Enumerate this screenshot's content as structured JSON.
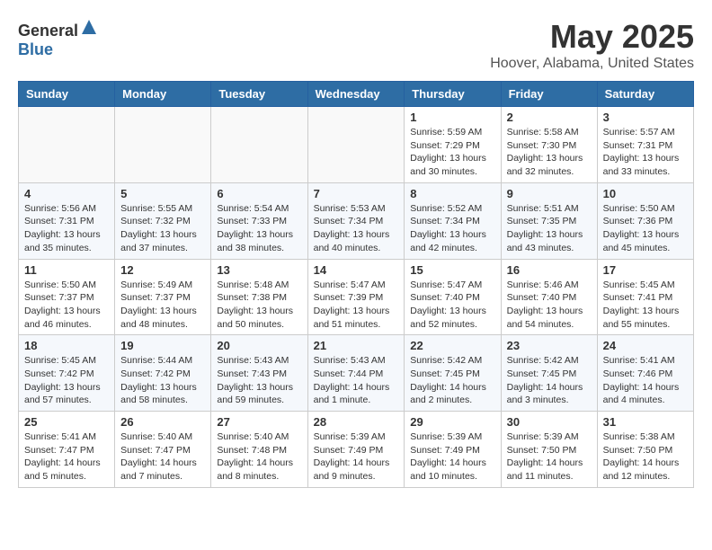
{
  "header": {
    "logo_general": "General",
    "logo_blue": "Blue",
    "month": "May 2025",
    "location": "Hoover, Alabama, United States"
  },
  "days_of_week": [
    "Sunday",
    "Monday",
    "Tuesday",
    "Wednesday",
    "Thursday",
    "Friday",
    "Saturday"
  ],
  "weeks": [
    [
      {
        "day": "",
        "info": ""
      },
      {
        "day": "",
        "info": ""
      },
      {
        "day": "",
        "info": ""
      },
      {
        "day": "",
        "info": ""
      },
      {
        "day": "1",
        "info": "Sunrise: 5:59 AM\nSunset: 7:29 PM\nDaylight: 13 hours and 30 minutes."
      },
      {
        "day": "2",
        "info": "Sunrise: 5:58 AM\nSunset: 7:30 PM\nDaylight: 13 hours and 32 minutes."
      },
      {
        "day": "3",
        "info": "Sunrise: 5:57 AM\nSunset: 7:31 PM\nDaylight: 13 hours and 33 minutes."
      }
    ],
    [
      {
        "day": "4",
        "info": "Sunrise: 5:56 AM\nSunset: 7:31 PM\nDaylight: 13 hours and 35 minutes."
      },
      {
        "day": "5",
        "info": "Sunrise: 5:55 AM\nSunset: 7:32 PM\nDaylight: 13 hours and 37 minutes."
      },
      {
        "day": "6",
        "info": "Sunrise: 5:54 AM\nSunset: 7:33 PM\nDaylight: 13 hours and 38 minutes."
      },
      {
        "day": "7",
        "info": "Sunrise: 5:53 AM\nSunset: 7:34 PM\nDaylight: 13 hours and 40 minutes."
      },
      {
        "day": "8",
        "info": "Sunrise: 5:52 AM\nSunset: 7:34 PM\nDaylight: 13 hours and 42 minutes."
      },
      {
        "day": "9",
        "info": "Sunrise: 5:51 AM\nSunset: 7:35 PM\nDaylight: 13 hours and 43 minutes."
      },
      {
        "day": "10",
        "info": "Sunrise: 5:50 AM\nSunset: 7:36 PM\nDaylight: 13 hours and 45 minutes."
      }
    ],
    [
      {
        "day": "11",
        "info": "Sunrise: 5:50 AM\nSunset: 7:37 PM\nDaylight: 13 hours and 46 minutes."
      },
      {
        "day": "12",
        "info": "Sunrise: 5:49 AM\nSunset: 7:37 PM\nDaylight: 13 hours and 48 minutes."
      },
      {
        "day": "13",
        "info": "Sunrise: 5:48 AM\nSunset: 7:38 PM\nDaylight: 13 hours and 50 minutes."
      },
      {
        "day": "14",
        "info": "Sunrise: 5:47 AM\nSunset: 7:39 PM\nDaylight: 13 hours and 51 minutes."
      },
      {
        "day": "15",
        "info": "Sunrise: 5:47 AM\nSunset: 7:40 PM\nDaylight: 13 hours and 52 minutes."
      },
      {
        "day": "16",
        "info": "Sunrise: 5:46 AM\nSunset: 7:40 PM\nDaylight: 13 hours and 54 minutes."
      },
      {
        "day": "17",
        "info": "Sunrise: 5:45 AM\nSunset: 7:41 PM\nDaylight: 13 hours and 55 minutes."
      }
    ],
    [
      {
        "day": "18",
        "info": "Sunrise: 5:45 AM\nSunset: 7:42 PM\nDaylight: 13 hours and 57 minutes."
      },
      {
        "day": "19",
        "info": "Sunrise: 5:44 AM\nSunset: 7:42 PM\nDaylight: 13 hours and 58 minutes."
      },
      {
        "day": "20",
        "info": "Sunrise: 5:43 AM\nSunset: 7:43 PM\nDaylight: 13 hours and 59 minutes."
      },
      {
        "day": "21",
        "info": "Sunrise: 5:43 AM\nSunset: 7:44 PM\nDaylight: 14 hours and 1 minute."
      },
      {
        "day": "22",
        "info": "Sunrise: 5:42 AM\nSunset: 7:45 PM\nDaylight: 14 hours and 2 minutes."
      },
      {
        "day": "23",
        "info": "Sunrise: 5:42 AM\nSunset: 7:45 PM\nDaylight: 14 hours and 3 minutes."
      },
      {
        "day": "24",
        "info": "Sunrise: 5:41 AM\nSunset: 7:46 PM\nDaylight: 14 hours and 4 minutes."
      }
    ],
    [
      {
        "day": "25",
        "info": "Sunrise: 5:41 AM\nSunset: 7:47 PM\nDaylight: 14 hours and 5 minutes."
      },
      {
        "day": "26",
        "info": "Sunrise: 5:40 AM\nSunset: 7:47 PM\nDaylight: 14 hours and 7 minutes."
      },
      {
        "day": "27",
        "info": "Sunrise: 5:40 AM\nSunset: 7:48 PM\nDaylight: 14 hours and 8 minutes."
      },
      {
        "day": "28",
        "info": "Sunrise: 5:39 AM\nSunset: 7:49 PM\nDaylight: 14 hours and 9 minutes."
      },
      {
        "day": "29",
        "info": "Sunrise: 5:39 AM\nSunset: 7:49 PM\nDaylight: 14 hours and 10 minutes."
      },
      {
        "day": "30",
        "info": "Sunrise: 5:39 AM\nSunset: 7:50 PM\nDaylight: 14 hours and 11 minutes."
      },
      {
        "day": "31",
        "info": "Sunrise: 5:38 AM\nSunset: 7:50 PM\nDaylight: 14 hours and 12 minutes."
      }
    ]
  ]
}
